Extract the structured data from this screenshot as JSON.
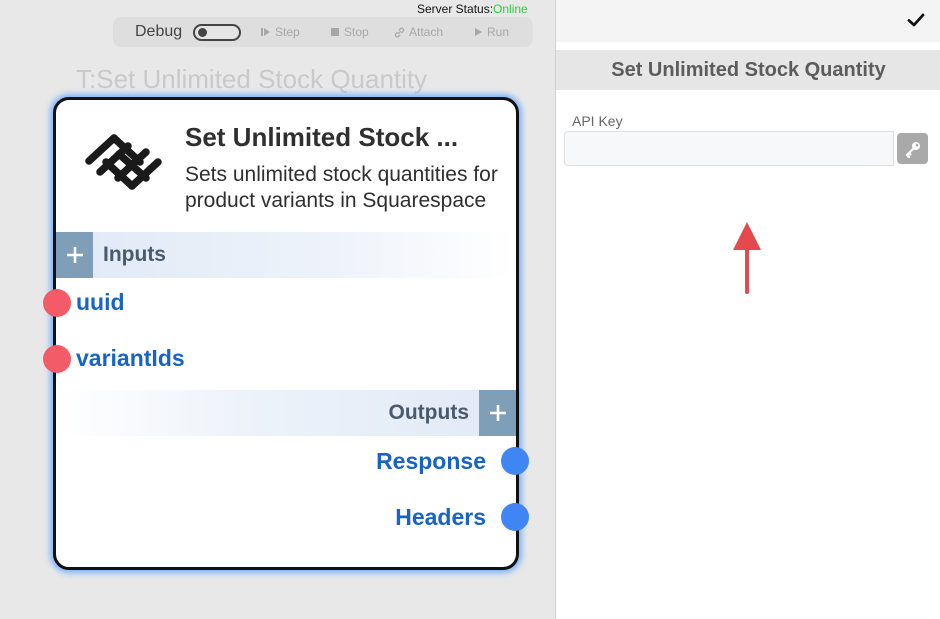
{
  "server_status": {
    "label": "Server Status:",
    "value": "Online",
    "value_color": "#2ecc40"
  },
  "toolbar": {
    "debug_label": "Debug",
    "debug_enabled": false,
    "step_label": "Step",
    "stop_label": "Stop",
    "attach_label": "Attach",
    "run_label": "Run"
  },
  "canvas": {
    "task_title": "T:Set Unlimited Stock Quantity"
  },
  "node": {
    "title": "Set Unlimited Stock ...",
    "description": "Sets unlimited stock quantities for product variants in Squarespace",
    "logo_icon": "squarespace-logo",
    "inputs_label": "Inputs",
    "outputs_label": "Outputs",
    "inputs": [
      "uuid",
      "variantIds"
    ],
    "outputs": [
      "Response",
      "Headers"
    ],
    "input_port_color": "#f35b68",
    "output_port_color": "#3f86f4"
  },
  "panel": {
    "confirm_icon": "checkmark-icon",
    "header": "Set Unlimited Stock Quantity",
    "api_key_label": "API Key",
    "api_key_value": "",
    "api_key_placeholder": "",
    "key_icon": "key-icon"
  }
}
